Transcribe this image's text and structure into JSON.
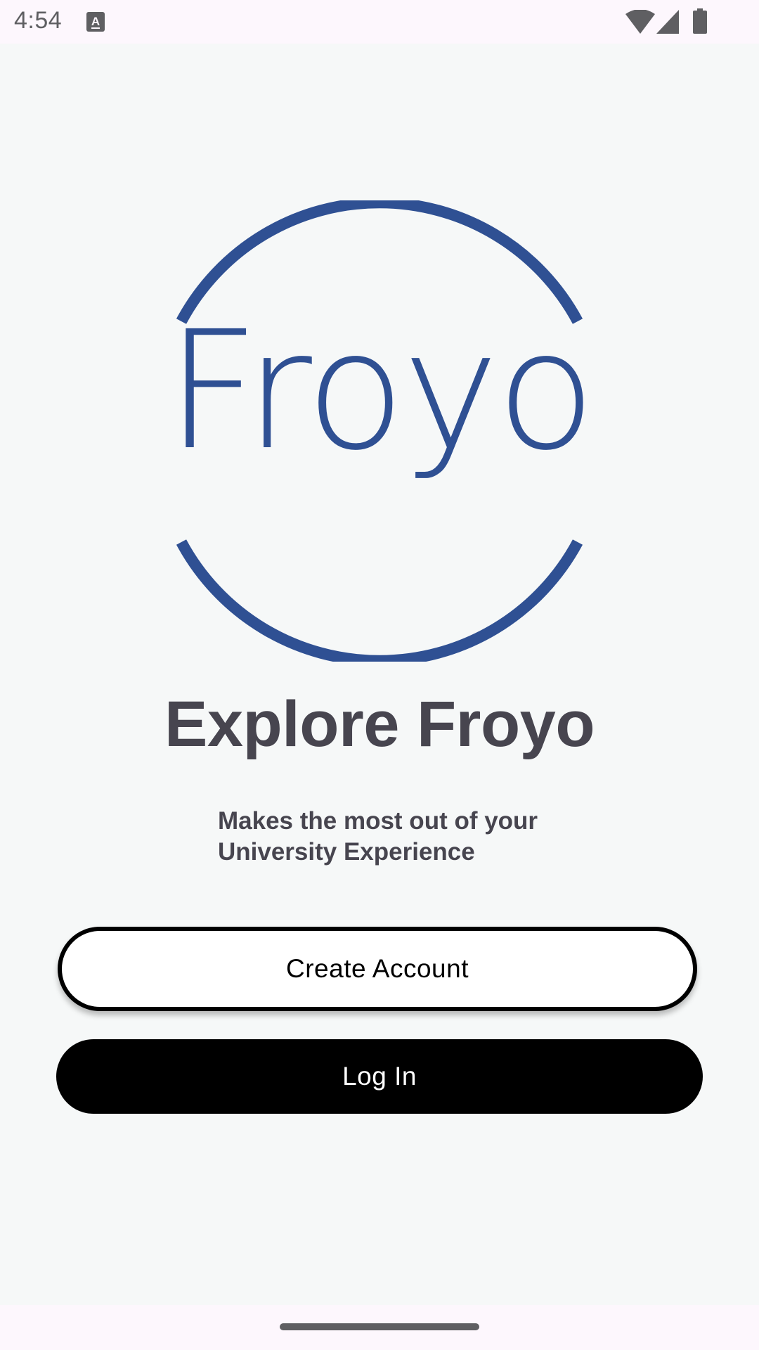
{
  "status_bar": {
    "time": "4:54",
    "icons": [
      "a-keyboard-icon",
      "wifi-icon",
      "signal-icon",
      "battery-icon"
    ]
  },
  "logo": {
    "text": "Froyo",
    "color": "#2f5093"
  },
  "main": {
    "headline": "Explore Froyo",
    "subtitle_line1": "Makes the most out of your",
    "subtitle_line2": "University Experience"
  },
  "buttons": {
    "create_account": "Create Account",
    "log_in": "Log In"
  },
  "colors": {
    "background": "#f6f8f8",
    "text_dark": "#47454f",
    "primary_button": "#000000",
    "secondary_button": "#ffffff"
  }
}
